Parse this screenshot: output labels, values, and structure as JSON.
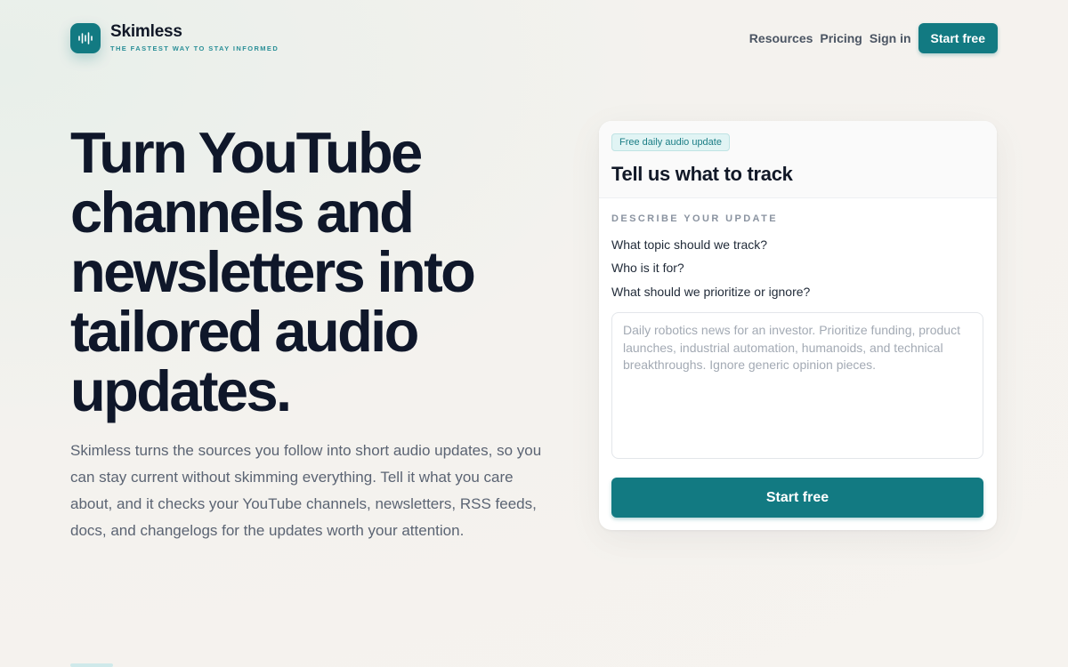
{
  "brand": {
    "name": "Skimless",
    "tagline": "THE FASTEST WAY TO STAY INFORMED",
    "icon": "waveform-icon",
    "accent": "#127a82"
  },
  "nav": {
    "links": [
      "Resources",
      "Pricing",
      "Sign in"
    ],
    "cta": "Start free"
  },
  "hero": {
    "title": "Turn YouTube channels and newsletters into tailored audio updates.",
    "description": "Skimless turns the sources you follow into short audio updates, so you can stay current without skimming everything. Tell it what you care about, and it checks your YouTube channels, newsletters, RSS feeds, docs, and changelogs for the updates worth your attention."
  },
  "card": {
    "badge": "Free daily audio update",
    "title": "Tell us what to track",
    "section_label": "DESCRIBE YOUR UPDATE",
    "questions": [
      "What topic should we track?",
      "Who is it for?",
      "What should we prioritize or ignore?"
    ],
    "textarea_value": "",
    "textarea_placeholder": "Daily robotics news for an investor. Prioritize funding, product launches, industrial automation, humanoids, and technical breakthroughs. Ignore generic opinion pieces.",
    "submit_label": "Start free"
  }
}
